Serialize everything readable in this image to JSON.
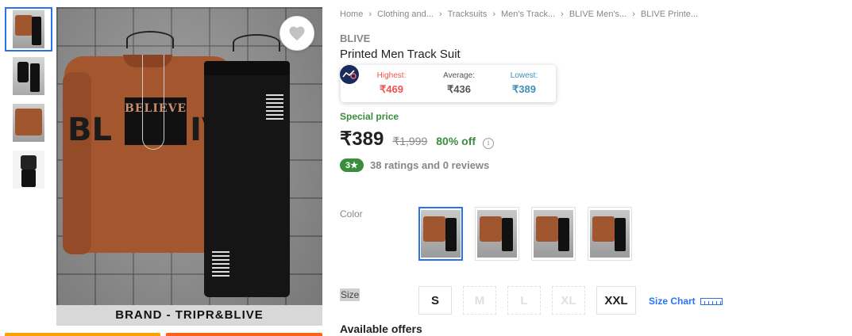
{
  "breadcrumb": [
    "Home",
    "Clothing and...",
    "Tracksuits",
    "Men's Track...",
    "BLIVE Men's...",
    "BLIVE Printe..."
  ],
  "product": {
    "brand": "BLIVE",
    "title": "Printed Men Track Suit",
    "image_banner": "BRAND - TRIPR&BLIVE",
    "print_text": "BELIEVE",
    "sleeve_left": "BL",
    "sleeve_right": "IV"
  },
  "price_history": {
    "highest_label": "Highest:",
    "highest_value": "₹469",
    "average_label": "Average:",
    "average_value": "₹436",
    "lowest_label": "Lowest:",
    "lowest_value": "₹389",
    "colors": {
      "highest": "#ef5350",
      "average": "#555555",
      "lowest": "#3d8fb5"
    }
  },
  "pricing": {
    "special_label": "Special price",
    "price": "₹389",
    "mrp": "₹1,999",
    "discount": "80% off",
    "info_glyph": "i"
  },
  "rating": {
    "badge": "3★",
    "summary": "38 ratings and 0 reviews"
  },
  "color": {
    "label": "Color",
    "swatch_count": 4,
    "selected_index": 0
  },
  "size": {
    "label": "Size",
    "options": [
      {
        "label": "S",
        "available": true
      },
      {
        "label": "M",
        "available": false
      },
      {
        "label": "L",
        "available": false
      },
      {
        "label": "XL",
        "available": false
      },
      {
        "label": "XXL",
        "available": true
      }
    ],
    "chart_label": "Size Chart"
  },
  "offers": {
    "title": "Available offers"
  },
  "icons": {
    "wishlist": "heart-icon",
    "tracker": "price-tracker-icon",
    "size_chart": "ruler-icon",
    "info": "info-icon"
  },
  "colors": {
    "accent": "#2874f0",
    "green": "#388e3c",
    "grey_text": "#878787"
  }
}
